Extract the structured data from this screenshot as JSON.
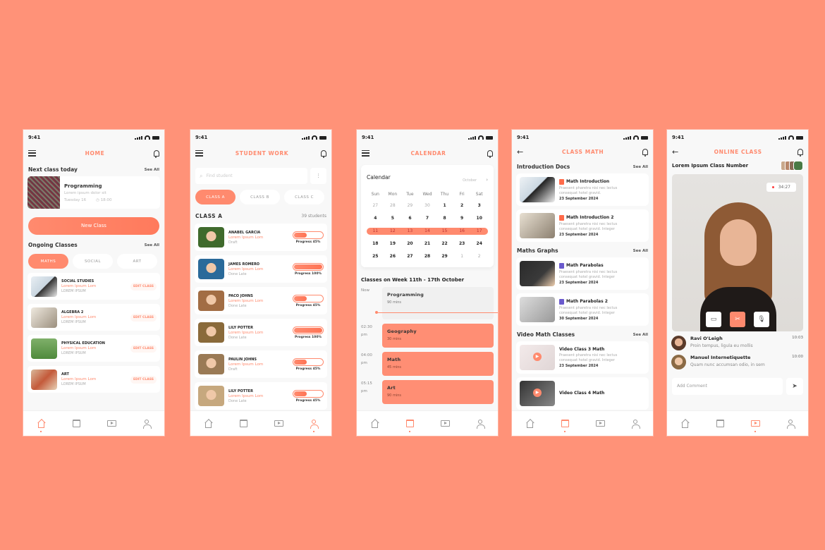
{
  "status_time": "9:41",
  "colors": {
    "accent": "#FF8A6E",
    "background": "#FF9278",
    "record_dot": "#FF3B3B"
  },
  "nav_items": [
    "home-icon",
    "calendar-icon",
    "video-icon",
    "user-icon"
  ],
  "home": {
    "title": "HOME",
    "next_class_heading": "Next class today",
    "see_all": "See All",
    "next_class": {
      "name": "Programming",
      "desc": "Lorem ipsum dolor sit",
      "day": "Tuesday 16",
      "time": "18:00"
    },
    "new_class_button": "New Class",
    "ongoing_heading": "Ongoing Classes",
    "tabs": [
      "MATHS",
      "SOCIAL",
      "ART"
    ],
    "active_tab": "MATHS",
    "classes": [
      {
        "name": "SOCIAL STUDIES",
        "sub": "Lorem Ipsum Lom",
        "meta": "LOREM IPSUM",
        "action": "EDIT CLASS"
      },
      {
        "name": "ALGEBRA 2",
        "sub": "Lorem Ipsum Lom",
        "meta": "LOREM IPSUM",
        "action": "EDIT CLASS"
      },
      {
        "name": "PHYSICAL EDUCATION",
        "sub": "Lorem Ipsum Lom",
        "meta": "LOREM IPSUM",
        "action": "EDIT CLASS"
      },
      {
        "name": "ART",
        "sub": "Lorem Ipsum Lom",
        "meta": "LOREM IPSUM",
        "action": "EDIT CLASS"
      }
    ]
  },
  "student_work": {
    "title": "STUDENT WORK",
    "search_placeholder": "Find student",
    "tabs": [
      "CLASS A",
      "CLASS B",
      "CLASS C"
    ],
    "active_tab": "CLASS A",
    "section_title": "CLASS A",
    "count": "39 students",
    "students": [
      {
        "name": "ANABEL GARCIA",
        "sub": "Lorem Ipsum Lom",
        "status": "Draft",
        "progress_label": "Progress 45%",
        "progress": 45
      },
      {
        "name": "JAMES ROMERO",
        "sub": "Lorem Ipsum Lom",
        "status": "Done Late",
        "progress_label": "Progress 100%",
        "progress": 100
      },
      {
        "name": "PACO JOHNS",
        "sub": "Lorem Ipsum Lom",
        "status": "Done Late",
        "progress_label": "Progress 45%",
        "progress": 45
      },
      {
        "name": "LILY POTTER",
        "sub": "Lorem Ipsum Lom",
        "status": "Done Late",
        "progress_label": "Progress 100%",
        "progress": 100
      },
      {
        "name": "PAULIN JOHNS",
        "sub": "Lorem Ipsum Lom",
        "status": "Draft",
        "progress_label": "Progress 45%",
        "progress": 45
      },
      {
        "name": "LILY POTTER",
        "sub": "Lorem Ipsum Lom",
        "status": "Done Late",
        "progress_label": "Progress 45%",
        "progress": 45
      }
    ]
  },
  "calendar": {
    "title": "CALENDAR",
    "card_title": "Calendar",
    "month": "October",
    "weekdays": [
      "Sun",
      "Mon",
      "Tue",
      "Wed",
      "Thu",
      "Fri",
      "Sat"
    ],
    "weeks": [
      [
        "27",
        "28",
        "29",
        "30",
        "1",
        "2",
        "3"
      ],
      [
        "4",
        "5",
        "6",
        "7",
        "8",
        "9",
        "10"
      ],
      [
        "11",
        "12",
        "13",
        "14",
        "15",
        "16",
        "17"
      ],
      [
        "18",
        "19",
        "20",
        "21",
        "22",
        "23",
        "24"
      ],
      [
        "25",
        "26",
        "27",
        "28",
        "29",
        "1",
        "2"
      ]
    ],
    "selected_week_index": 2,
    "schedule_heading": "Classes on Week 11th - 17th October",
    "schedule": [
      {
        "time": "Now",
        "period": "",
        "name": "Programming",
        "duration": "90 mins",
        "current": true
      },
      {
        "time": "02:30",
        "period": "pm",
        "name": "Geography",
        "duration": "30 mins",
        "current": false
      },
      {
        "time": "04:00",
        "period": "pm",
        "name": "Math",
        "duration": "45 mins",
        "current": false
      },
      {
        "time": "05:15",
        "period": "pm",
        "name": "Art",
        "duration": "90 mins",
        "current": false
      }
    ]
  },
  "class_math": {
    "title": "CLASS MATH",
    "see_all": "See All",
    "sections": [
      {
        "heading": "Introduction Docs",
        "items": [
          {
            "title": "Math Introduction",
            "desc1": "Praesent pharetra nisi nec lectus",
            "desc2": "consequat hotel gravid.",
            "date": "23 September 2024",
            "icon": "pdf-icon"
          },
          {
            "title": "Math Introduction 2",
            "desc1": "Praesent pharetra nisi nec lectus",
            "desc2": "consequat hotel gravid. Integer",
            "date": "23 September 2024",
            "icon": "pdf-icon"
          }
        ]
      },
      {
        "heading": "Maths Graphs",
        "items": [
          {
            "title": "Math Parabolas",
            "desc1": "Praesent pharetra nisi nec lectus",
            "desc2": "consequat hotel gravid. Integer",
            "date": "23 September 2024",
            "icon": "image-icon"
          },
          {
            "title": "Math Parabolas 2",
            "desc1": "Praesent pharetra nisi nec lectus",
            "desc2": "consequat hotel gravid. Integer",
            "date": "30 September 2024",
            "icon": "image-icon"
          }
        ]
      },
      {
        "heading": "Video Math Classes",
        "items": [
          {
            "title": "Video Class 3 Math",
            "desc1": "Praesent pharetra nisi nec lectus",
            "desc2": "consequat hotel gravid. Integer",
            "date": "23 September 2024",
            "icon": "play-icon"
          },
          {
            "title": "Video Class 4 Math",
            "desc1": "",
            "desc2": "",
            "date": "",
            "icon": "play-icon"
          }
        ]
      }
    ]
  },
  "online_class": {
    "title": "ONLINE CLASS",
    "class_name": "Lorem Ipsum Class Number",
    "timer": "34:27",
    "comments": [
      {
        "name": "Ravi O'Leigh",
        "time": "10:03",
        "text": "Proin tempus, ligula eu mollis"
      },
      {
        "name": "Manuel Internetiquette",
        "time": "10:00",
        "text": "Quam nunc accumsan odio, in sem"
      }
    ],
    "comment_placeholder": "Add Comment"
  }
}
